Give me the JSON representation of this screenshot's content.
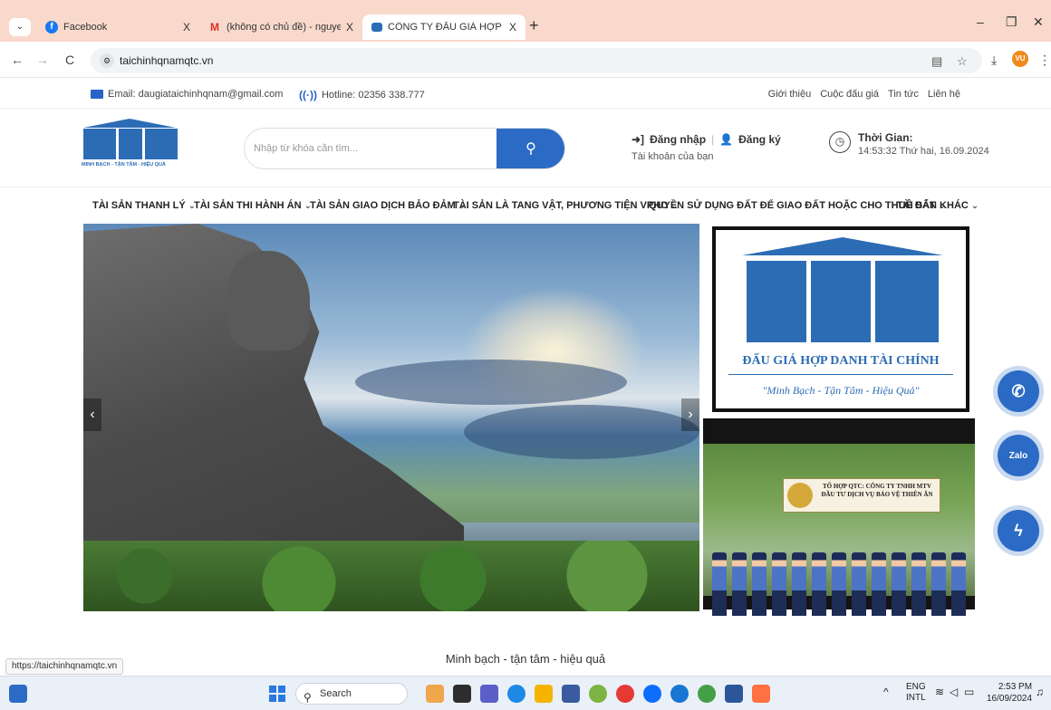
{
  "browser": {
    "tabs": [
      {
        "title": "Facebook",
        "close": "X"
      },
      {
        "title": "(không có chủ đề) - nguyenduc",
        "close": "X"
      },
      {
        "title": "CÔNG TY ĐẤU GIÁ HỢP DANH",
        "close": "X"
      }
    ],
    "tab_dropdown": "⌄",
    "new_tab": "+",
    "window_controls": [
      "–",
      "❐",
      "✕"
    ],
    "nav": {
      "back": "←",
      "forward": "→",
      "reload": "C"
    },
    "url": "taichinhqnamqtc.vn",
    "avatar_initials": "VU",
    "status_url": "https://taichinhqnamqtc.vn"
  },
  "site": {
    "topbar": {
      "email": "Email: daugiataichinhqnam@gmail.com",
      "hotline": "Hotline: 02356 338.777",
      "links": [
        "Giới thiệu",
        "Cuộc đấu giá",
        "Tin tức",
        "Liên hệ"
      ]
    },
    "logo": {
      "tagline": "MINH BẠCH - TẬN TÂM - HIỆU QUẢ"
    },
    "search": {
      "placeholder": "Nhập từ khóa cần tìm..."
    },
    "auth": {
      "login": "Đăng nhập",
      "register": "Đăng ký",
      "separator": "|",
      "subtitle": "Tài khoản của bạn"
    },
    "clock": {
      "label": "Thời Gian:",
      "value": "14:53:32 Thứ hai, 16.09.2024"
    },
    "menu": [
      "TÀI SẢN THANH LÝ",
      "TÀI SẢN THI HÀNH ÁN",
      "TÀI SẢN GIAO DỊCH BẢO ĐẢM",
      "TÀI SẢN LÀ TANG VẬT, PHƯƠNG TIỆN VPHC",
      "QUYỀN SỬ DỤNG ĐẤT ĐỂ GIAO ĐẤT HOẶC CHO THUÊ ĐẤT",
      "TÀI SẢN KHÁC"
    ],
    "slider": {
      "prev": "‹",
      "next": "›"
    },
    "banner_logo": {
      "title": "ĐẤU GIÁ HỢP DANH TÀI CHÍNH",
      "slogan": "\"Minh Bạch - Tận Tâm - Hiệu Quả\""
    },
    "banner_security": {
      "sign": "TỔ HỢP QTC: CÔNG TY TNHH MTV ĐẦU TƯ DỊCH VỤ BẢO VỆ THIÊN ÂN"
    },
    "slogan": "Minh bạch - tận tâm - hiệu quả"
  },
  "taskbar": {
    "search": "Search",
    "lang": "ENG",
    "layout": "INTL",
    "time": "2:53 PM",
    "date": "16/09/2024"
  },
  "colors": {
    "brand_blue": "#2c6cb5",
    "button_blue": "#2b6bc5",
    "tab_bar": "#f9d9cc"
  }
}
